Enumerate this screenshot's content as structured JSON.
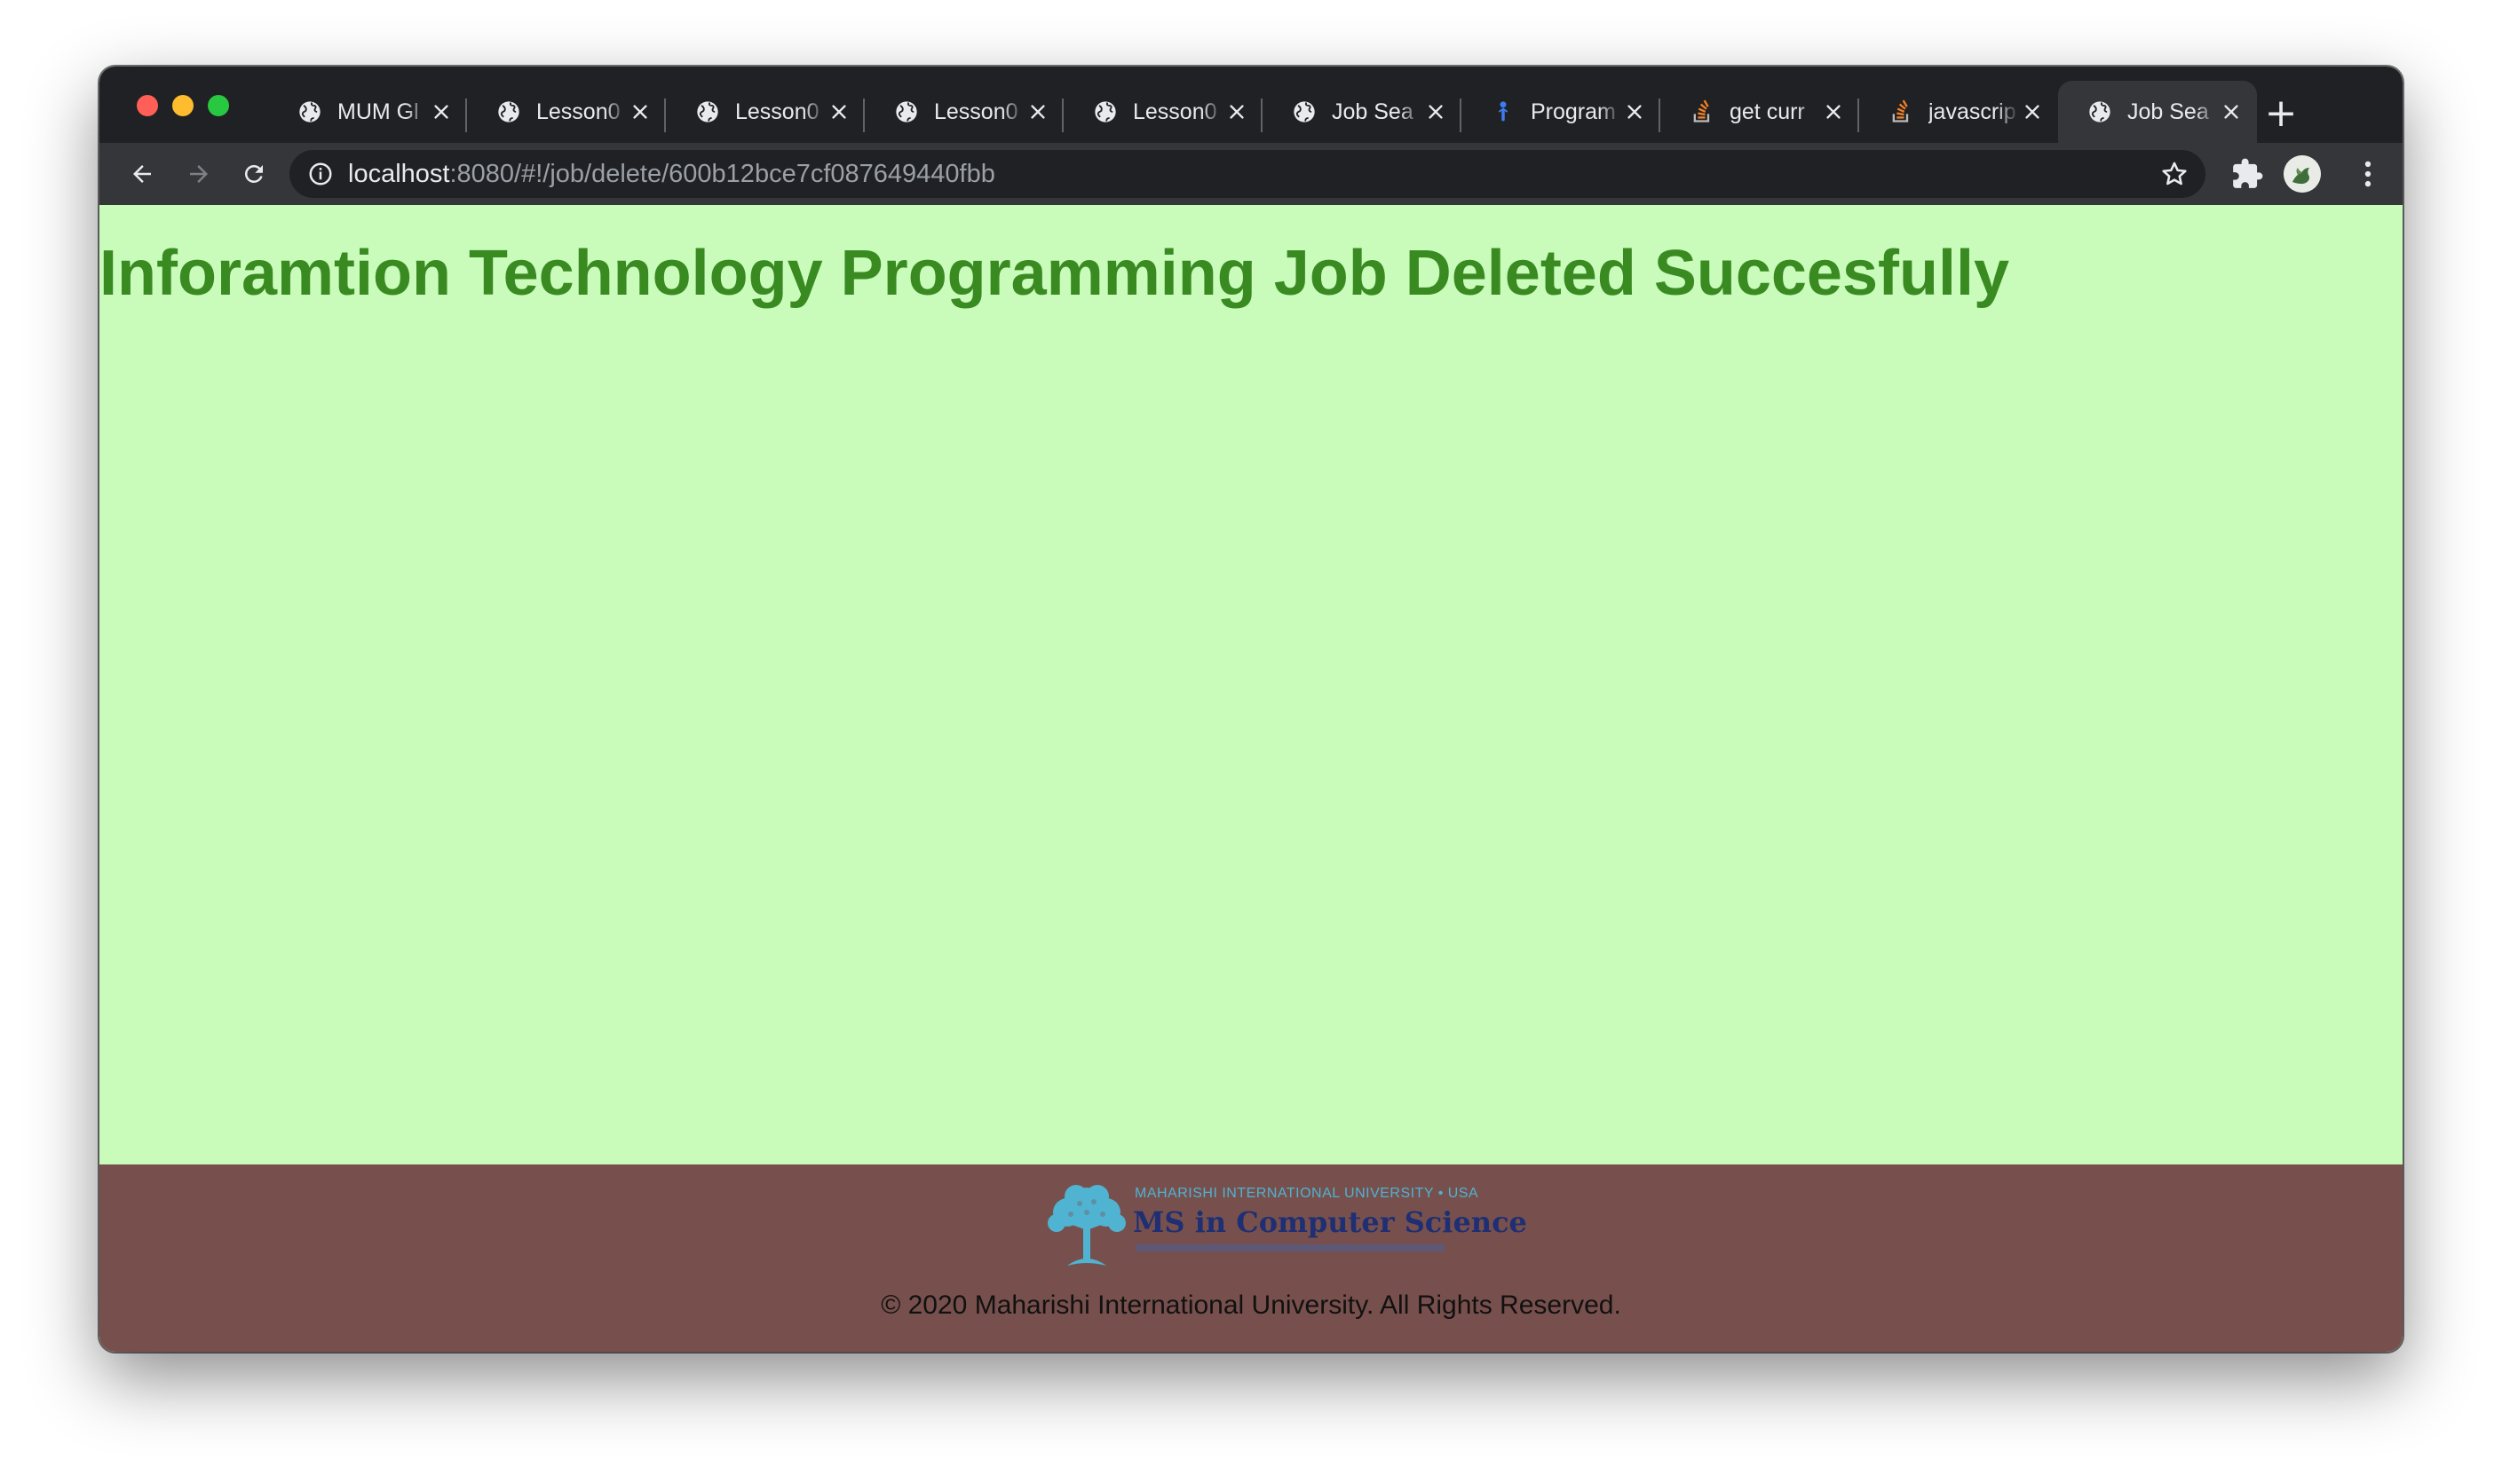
{
  "browser": {
    "tabs": [
      {
        "title": "MUM Gl",
        "icon": "globe-icon",
        "active": false
      },
      {
        "title": "Lesson0",
        "icon": "globe-icon",
        "active": false
      },
      {
        "title": "Lesson0",
        "icon": "globe-icon",
        "active": false
      },
      {
        "title": "Lesson0",
        "icon": "globe-icon",
        "active": false
      },
      {
        "title": "Lesson0",
        "icon": "globe-icon",
        "active": false
      },
      {
        "title": "Job Sea",
        "icon": "globe-icon",
        "active": false
      },
      {
        "title": "Program",
        "icon": "programiz-icon",
        "active": false
      },
      {
        "title": "get curr",
        "icon": "stackoverflow-icon",
        "active": false
      },
      {
        "title": "javascrip",
        "icon": "stackoverflow-icon",
        "active": false
      },
      {
        "title": "Job Sea",
        "icon": "globe-icon",
        "active": true
      }
    ],
    "address_bar": {
      "host": "localhost",
      "path": ":8080/#!/job/delete/600b12bce7cf087649440fbb"
    }
  },
  "page": {
    "headline": "Inforamtion Technology Programming Job Deleted Succesfully",
    "colors": {
      "background": "#c9fbbb",
      "headline": "#3a8a22",
      "footer": "#77504d"
    }
  },
  "footer": {
    "logo": {
      "university": "MAHARISHI INTERNATIONAL UNIVERSITY • USA",
      "program": "MS in Computer Science"
    },
    "copyright": "© 2020 Maharishi International University. All Rights Reserved."
  }
}
